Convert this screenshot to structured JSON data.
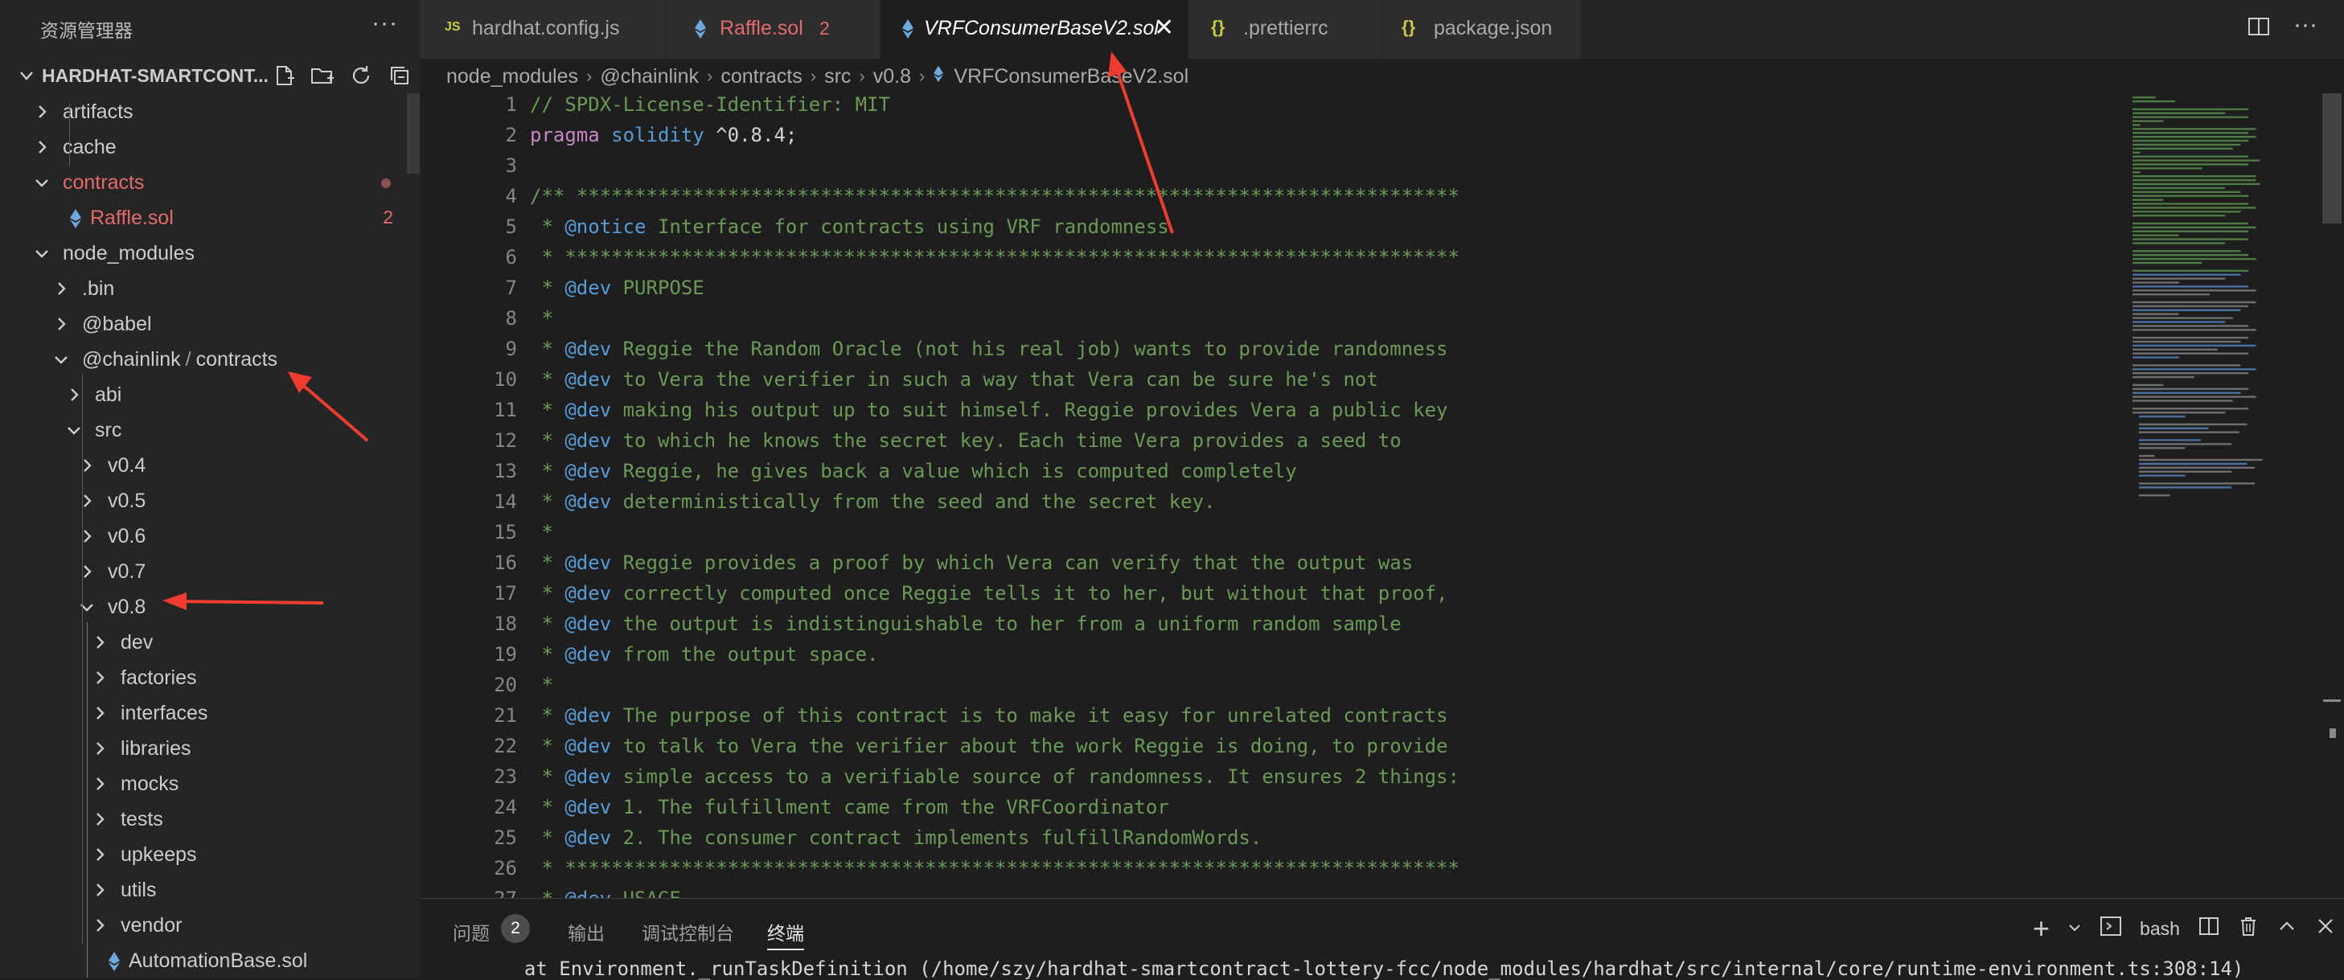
{
  "colors": {
    "sidebar_bg": "#252526",
    "editor_bg": "#1e1e1e",
    "error_red": "#e26a6a",
    "json_yellow": "#cbcb41",
    "annotation_red": "#f03c2f"
  },
  "sidebar": {
    "title": "资源管理器",
    "more": "···",
    "project": "HARDHAT-SMARTCONT...",
    "actions": [
      "new-file-icon",
      "new-folder-icon",
      "refresh-icon",
      "collapse-all-icon"
    ],
    "tree": [
      {
        "name": "artifacts",
        "depth": 0,
        "type": "folder",
        "open": false
      },
      {
        "name": "cache",
        "depth": 0,
        "type": "folder",
        "open": false
      },
      {
        "name": "contracts",
        "depth": 0,
        "type": "folder",
        "open": true,
        "status": "error"
      },
      {
        "name": "Raffle.sol",
        "depth": 1,
        "type": "sol",
        "badge": "2",
        "status": "error"
      },
      {
        "name": "node_modules",
        "depth": 0,
        "type": "folder",
        "open": true
      },
      {
        "name": ".bin",
        "depth": 1,
        "type": "folder",
        "open": false
      },
      {
        "name": "@babel",
        "depth": 1,
        "type": "folder",
        "open": false
      },
      {
        "name": "@chainlink",
        "name2": "contracts",
        "depth": 1,
        "type": "folder",
        "open": true
      },
      {
        "name": "abi",
        "depth": 2,
        "type": "folder",
        "open": false
      },
      {
        "name": "src",
        "depth": 2,
        "type": "folder",
        "open": true
      },
      {
        "name": "v0.4",
        "depth": 3,
        "type": "folder",
        "open": false
      },
      {
        "name": "v0.5",
        "depth": 3,
        "type": "folder",
        "open": false
      },
      {
        "name": "v0.6",
        "depth": 3,
        "type": "folder",
        "open": false
      },
      {
        "name": "v0.7",
        "depth": 3,
        "type": "folder",
        "open": false
      },
      {
        "name": "v0.8",
        "depth": 3,
        "type": "folder",
        "open": true
      },
      {
        "name": "dev",
        "depth": 4,
        "type": "folder",
        "open": false
      },
      {
        "name": "factories",
        "depth": 4,
        "type": "folder",
        "open": false
      },
      {
        "name": "interfaces",
        "depth": 4,
        "type": "folder",
        "open": false
      },
      {
        "name": "libraries",
        "depth": 4,
        "type": "folder",
        "open": false
      },
      {
        "name": "mocks",
        "depth": 4,
        "type": "folder",
        "open": false
      },
      {
        "name": "tests",
        "depth": 4,
        "type": "folder",
        "open": false
      },
      {
        "name": "upkeeps",
        "depth": 4,
        "type": "folder",
        "open": false
      },
      {
        "name": "utils",
        "depth": 4,
        "type": "folder",
        "open": false
      },
      {
        "name": "vendor",
        "depth": 4,
        "type": "folder",
        "open": false
      },
      {
        "name": "AutomationBase.sol",
        "depth": 4,
        "type": "sol"
      }
    ]
  },
  "tabs": [
    {
      "label": "hardhat.config.js",
      "icon": "js",
      "active": false
    },
    {
      "label": "Raffle.sol",
      "icon": "sol",
      "badge": "2",
      "active": false,
      "status": "error"
    },
    {
      "label": "VRFConsumerBaseV2.sol",
      "icon": "sol",
      "active": true,
      "close": "✕"
    },
    {
      "label": ".prettierrc",
      "icon": "json",
      "active": false
    },
    {
      "label": "package.json",
      "icon": "json",
      "active": false
    }
  ],
  "breadcrumb": [
    "node_modules",
    "@chainlink",
    "contracts",
    "src",
    "v0.8",
    "VRFConsumerBaseV2.sol"
  ],
  "editor": {
    "lines": [
      {
        "n": "1",
        "t": "// SPDX-License-Identifier: MIT"
      },
      {
        "n": "2",
        "t": "pragma solidity ^0.8.4;"
      },
      {
        "n": "3",
        "t": ""
      },
      {
        "n": "4",
        "t": "/** ****************************************************************************"
      },
      {
        "n": "5",
        "t": " * @notice Interface for contracts using VRF randomness"
      },
      {
        "n": "6",
        "t": " * *****************************************************************************"
      },
      {
        "n": "7",
        "t": " * @dev PURPOSE"
      },
      {
        "n": "8",
        "t": " *"
      },
      {
        "n": "9",
        "t": " * @dev Reggie the Random Oracle (not his real job) wants to provide randomness"
      },
      {
        "n": "10",
        "t": " * @dev to Vera the verifier in such a way that Vera can be sure he's not"
      },
      {
        "n": "11",
        "t": " * @dev making his output up to suit himself. Reggie provides Vera a public key"
      },
      {
        "n": "12",
        "t": " * @dev to which he knows the secret key. Each time Vera provides a seed to"
      },
      {
        "n": "13",
        "t": " * @dev Reggie, he gives back a value which is computed completely"
      },
      {
        "n": "14",
        "t": " * @dev deterministically from the seed and the secret key."
      },
      {
        "n": "15",
        "t": " *"
      },
      {
        "n": "16",
        "t": " * @dev Reggie provides a proof by which Vera can verify that the output was"
      },
      {
        "n": "17",
        "t": " * @dev correctly computed once Reggie tells it to her, but without that proof,"
      },
      {
        "n": "18",
        "t": " * @dev the output is indistinguishable to her from a uniform random sample"
      },
      {
        "n": "19",
        "t": " * @dev from the output space."
      },
      {
        "n": "20",
        "t": " *"
      },
      {
        "n": "21",
        "t": " * @dev The purpose of this contract is to make it easy for unrelated contracts"
      },
      {
        "n": "22",
        "t": " * @dev to talk to Vera the verifier about the work Reggie is doing, to provide"
      },
      {
        "n": "23",
        "t": " * @dev simple access to a verifiable source of randomness. It ensures 2 things:"
      },
      {
        "n": "24",
        "t": " * @dev 1. The fulfillment came from the VRFCoordinator"
      },
      {
        "n": "25",
        "t": " * @dev 2. The consumer contract implements fulfillRandomWords."
      },
      {
        "n": "26",
        "t": " * *****************************************************************************"
      },
      {
        "n": "27",
        "t": " * @dev USAGE"
      }
    ]
  },
  "panel": {
    "tabs": [
      "问题",
      "输出",
      "调试控制台",
      "终端"
    ],
    "active": "终端",
    "problems_count": "2",
    "shell": "bash",
    "terminal_line": "  at Environment._runTaskDefinition (/home/szy/hardhat-smartcontract-lottery-fcc/node_modules/hardhat/src/internal/core/runtime-environment.ts:308:14)"
  },
  "annotations": [
    "arrow-to-chainlink",
    "arrow-to-v08",
    "arrow-to-active-tab"
  ]
}
